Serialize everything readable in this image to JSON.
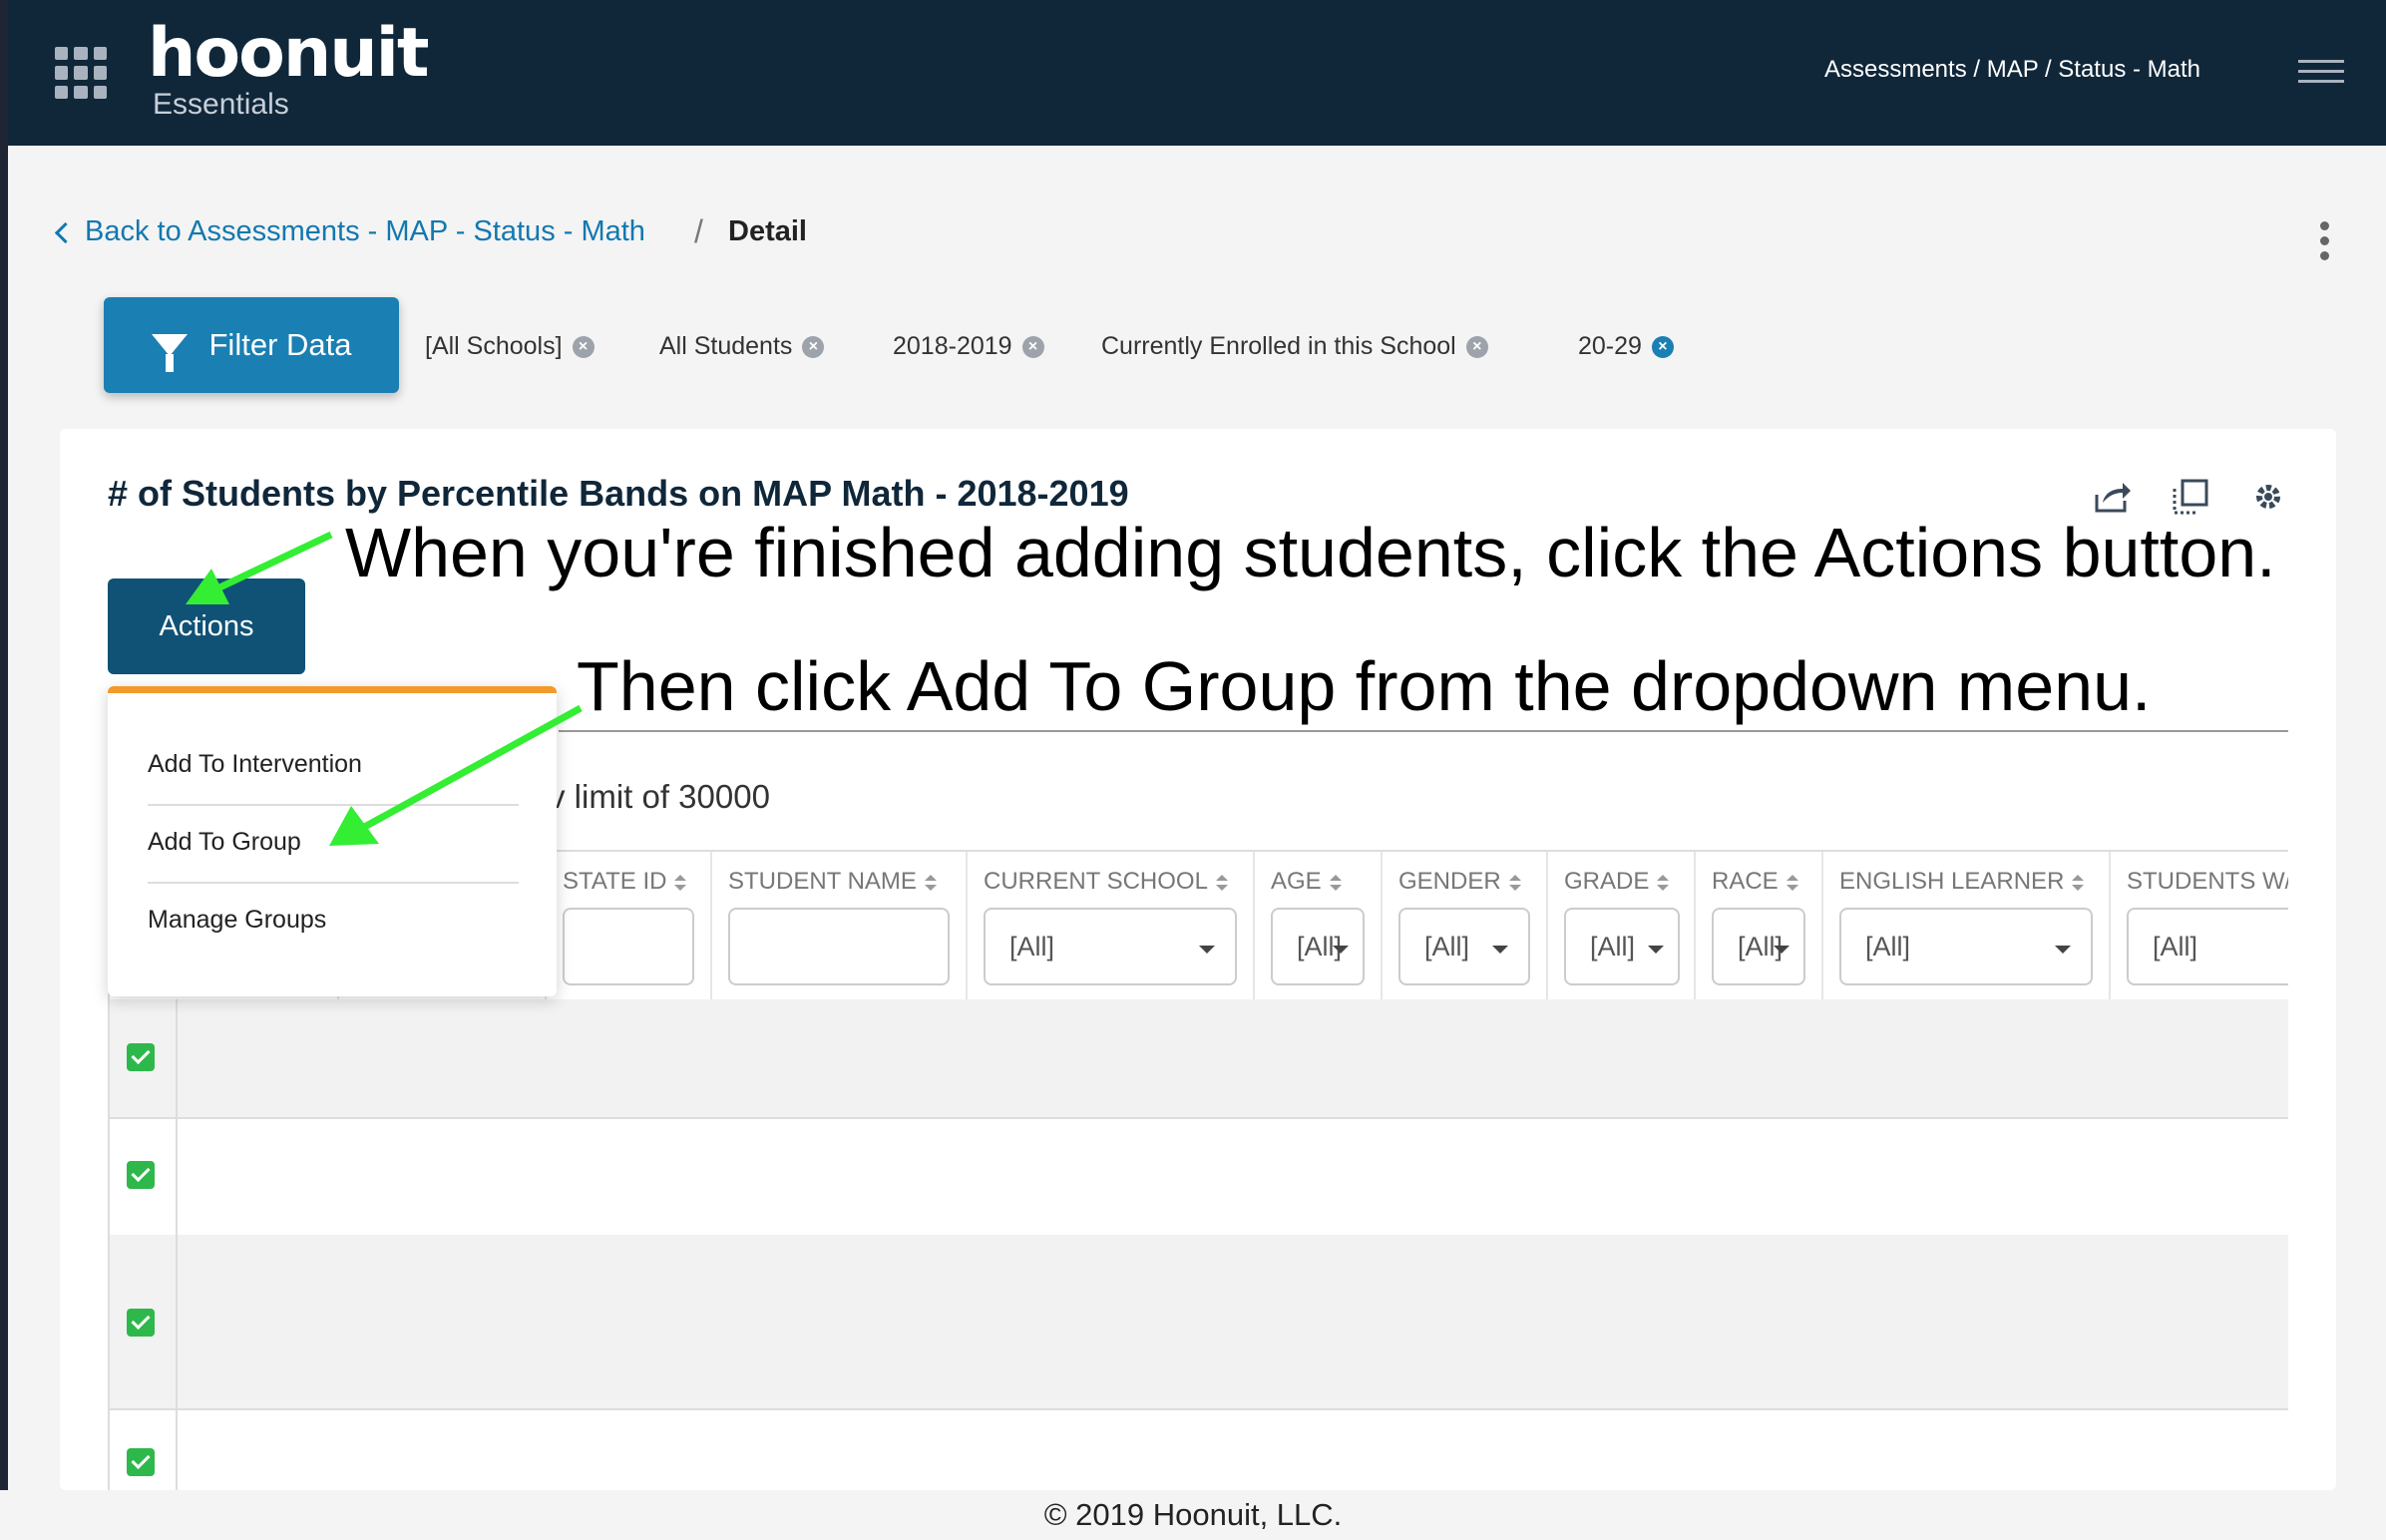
{
  "header": {
    "logo": "hoonuit",
    "logo_sub": "Essentials",
    "breadcrumb": "Assessments / MAP / Status - Math",
    "icons": [
      "apps-grid-icon",
      "hamburger-menu-icon"
    ]
  },
  "breadcrumb": {
    "back_label": "Back to Assessments - MAP - Status - Math",
    "separator": "/",
    "current": "Detail"
  },
  "filters": {
    "button_label": "Filter Data",
    "chips": [
      "[All Schools]",
      "All Students",
      "2018-2019",
      "Currently Enrolled in this School",
      "20-29"
    ]
  },
  "panel": {
    "title": "# of Students by Percentile Bands on MAP Math - 2018-2019",
    "actions_label": "Actions",
    "menu": [
      "Add To Intervention",
      "Add To Group",
      "Manage Groups"
    ],
    "row_limit_text": "limit of 30000",
    "row_limit_prefix": "v"
  },
  "table": {
    "columns": [
      {
        "label": "STATE ID",
        "filter": ""
      },
      {
        "label": "STUDENT NAME",
        "filter": ""
      },
      {
        "label": "CURRENT SCHOOL",
        "filter": "[All]"
      },
      {
        "label": "AGE",
        "filter": "[All]"
      },
      {
        "label": "GENDER",
        "filter": "[All]"
      },
      {
        "label": "GRADE",
        "filter": "[All]"
      },
      {
        "label": "RACE",
        "filter": "[All]"
      },
      {
        "label": "ENGLISH LEARNER",
        "filter": "[All]"
      },
      {
        "label": "STUDENTS W/",
        "filter": "[All]"
      }
    ],
    "rows_checked": [
      true,
      true,
      true,
      true
    ]
  },
  "annotations": {
    "line1": "When you're finished adding students, click the Actions button.",
    "line2": "Then click Add To Group from the dropdown menu.",
    "arrow_color": "#33ee33"
  },
  "footer": "© 2019 Hoonuit, LLC.",
  "colors": {
    "header_bg": "#10273a",
    "primary": "#1a7fb2",
    "actions_bg": "#0f5275",
    "menu_accent": "#f39a2b",
    "check": "#2eb84b"
  }
}
